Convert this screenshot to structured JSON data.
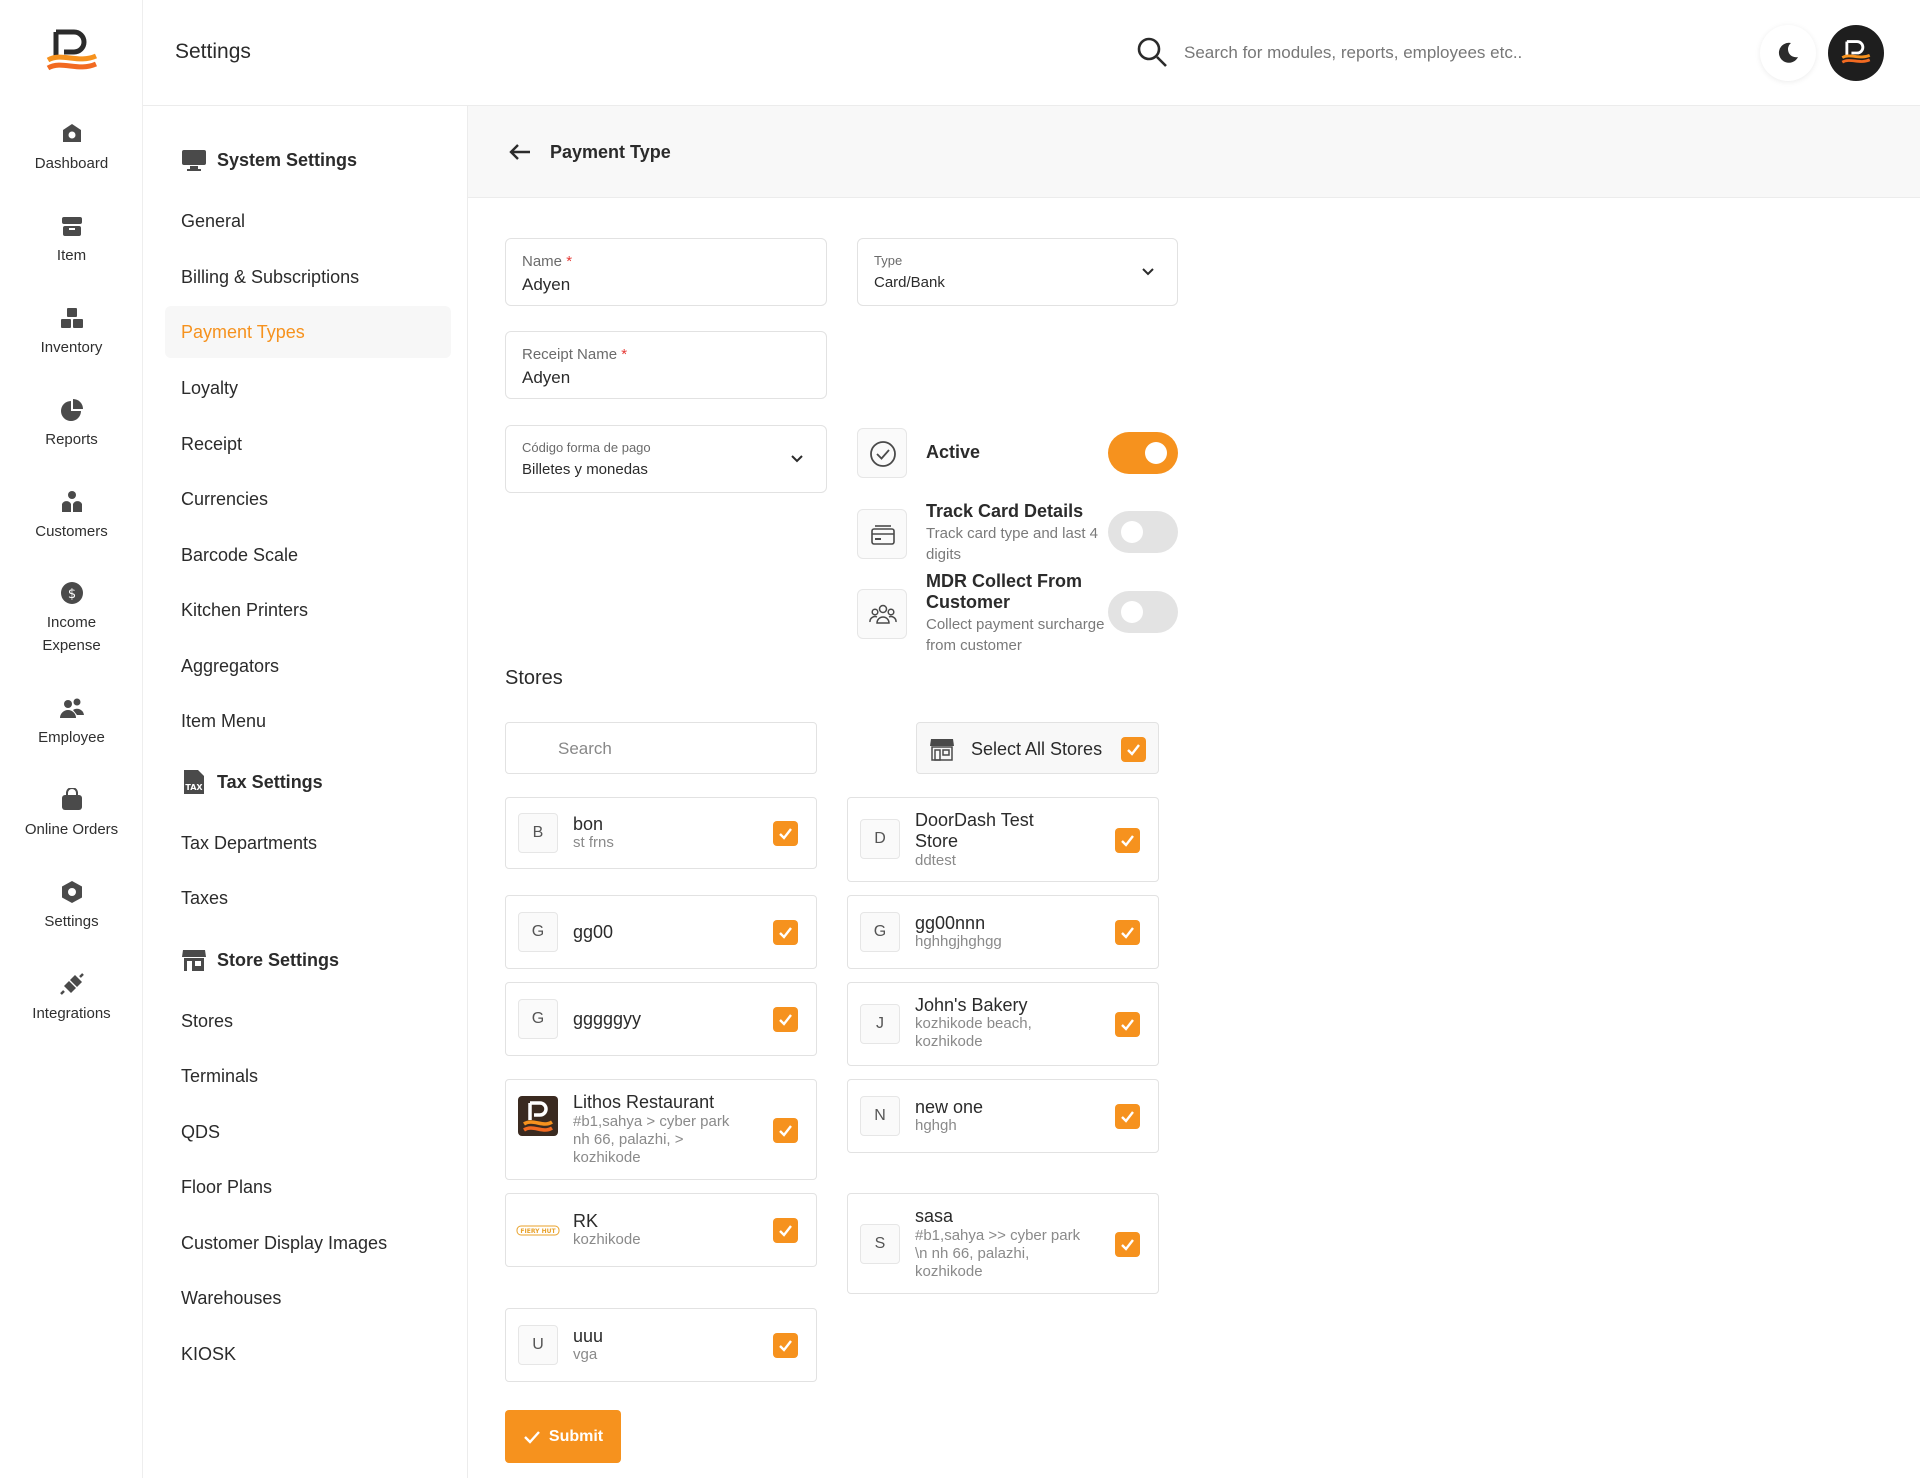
{
  "header": {
    "title": "Settings",
    "search_placeholder": "Search for modules, reports, employees etc.."
  },
  "rail": {
    "items": [
      {
        "label": "Dashboard",
        "icon": "dashboard-icon"
      },
      {
        "label": "Item",
        "icon": "item-icon"
      },
      {
        "label": "Inventory",
        "icon": "inventory-icon"
      },
      {
        "label": "Reports",
        "icon": "reports-icon"
      },
      {
        "label": "Customers",
        "icon": "customers-icon"
      },
      {
        "label": "Income Expense",
        "icon": "income-expense-icon"
      },
      {
        "label": "Employee",
        "icon": "employee-icon"
      },
      {
        "label": "Online Orders",
        "icon": "online-orders-icon"
      },
      {
        "label": "Settings",
        "icon": "settings-icon"
      },
      {
        "label": "Integrations",
        "icon": "integrations-icon"
      }
    ]
  },
  "nav": {
    "system_settings": "System Settings",
    "system_items": [
      "General",
      "Billing & Subscriptions",
      "Payment Types",
      "Loyalty",
      "Receipt",
      "Currencies",
      "Barcode Scale",
      "Kitchen Printers",
      "Aggregators",
      "Item Menu"
    ],
    "tax_settings": "Tax Settings",
    "tax_items": [
      "Tax Departments",
      "Taxes"
    ],
    "store_settings": "Store Settings",
    "store_items": [
      "Stores",
      "Terminals",
      "QDS",
      "Floor Plans",
      "Customer Display Images",
      "Warehouses",
      "KIOSK"
    ],
    "active": "Payment Types"
  },
  "form": {
    "title": "Payment Type",
    "name_label": "Name",
    "name_value": "Adyen",
    "type_label": "Type",
    "type_value": "Card/Bank",
    "receipt_label": "Receipt Name",
    "receipt_value": "Adyen",
    "codigo_label": "Código forma de pago",
    "codigo_value": "Billetes y monedas",
    "required_mark": "*",
    "active_label": "Active",
    "active_on": true,
    "track_title": "Track Card Details",
    "track_sub": "Track card type and last 4 digits",
    "track_on": false,
    "mdr_title": "MDR Collect From Customer",
    "mdr_sub": "Collect payment surcharge from customer",
    "mdr_on": false
  },
  "stores": {
    "heading": "Stores",
    "search_placeholder": "Search",
    "select_all_label": "Select All Stores",
    "list": [
      {
        "initial": "B",
        "name": "bon",
        "sub": "st frns",
        "checked": true
      },
      {
        "initial": "D",
        "name": "DoorDash Test Store",
        "sub": "ddtest",
        "checked": true
      },
      {
        "initial": "G",
        "name": "gg00",
        "sub": "",
        "checked": true
      },
      {
        "initial": "G",
        "name": "gg00nnn",
        "sub": "hghhgjhghgg",
        "checked": true
      },
      {
        "initial": "G",
        "name": "gggggyy",
        "sub": "",
        "checked": true
      },
      {
        "initial": "J",
        "name": "John's Bakery",
        "sub": "kozhikode beach, kozhikode",
        "checked": true
      },
      {
        "initial": "",
        "name": "Lithos Restaurant",
        "sub": "#b1,sahya > cyber park nh 66, palazhi, > kozhikode",
        "checked": true
      },
      {
        "initial": "N",
        "name": "new one",
        "sub": "hghgh",
        "checked": true
      },
      {
        "initial": "",
        "name": "RK",
        "sub": "kozhikode",
        "checked": true,
        "logo_text": "FIERY HUT"
      },
      {
        "initial": "S",
        "name": "sasa",
        "sub": "#b1,sahya >> cyber park \\n nh 66, palazhi, kozhikode",
        "checked": true
      },
      {
        "initial": "U",
        "name": "uuu",
        "sub": "vga",
        "checked": true
      }
    ]
  },
  "submit_label": "Submit",
  "colors": {
    "accent": "#f6921e",
    "text": "#2b2b2b",
    "muted": "#7a7a7a",
    "required": "#e53935"
  }
}
